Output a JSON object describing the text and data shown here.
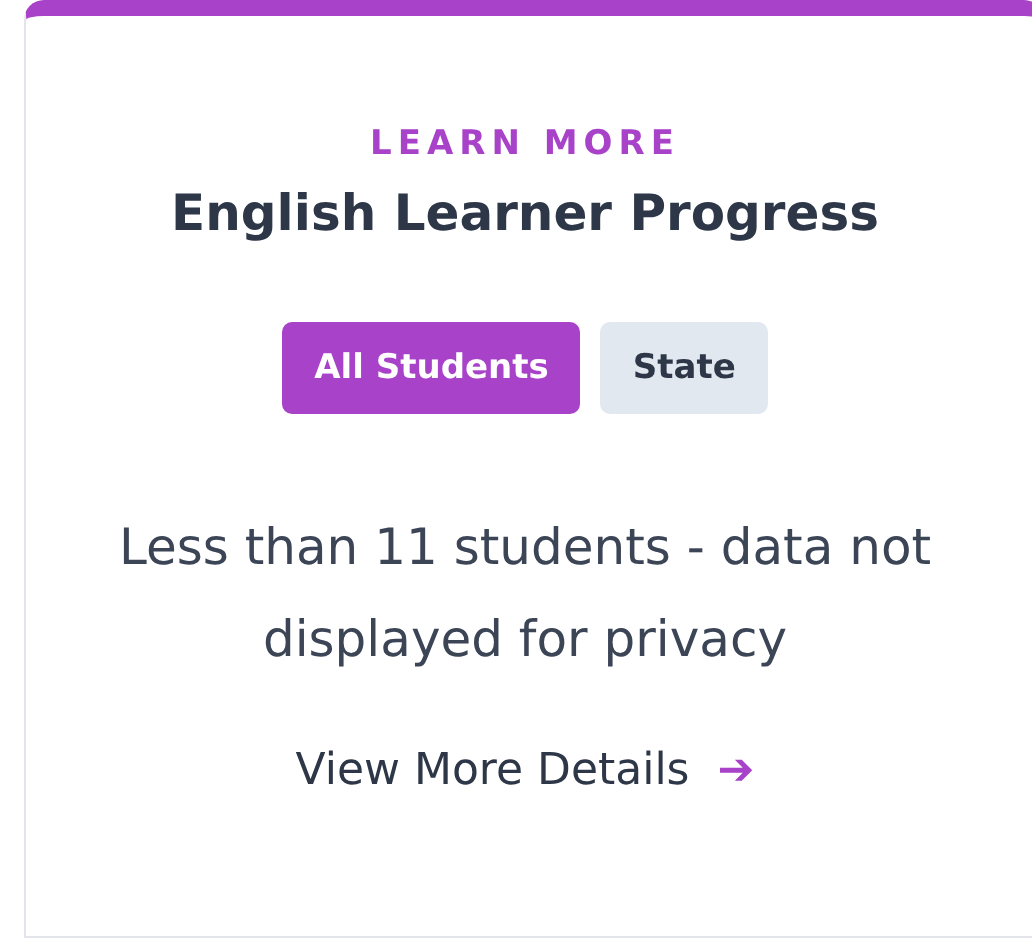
{
  "card": {
    "eyebrow": "LEARN MORE",
    "title": "English Learner Progress",
    "tabs": [
      {
        "label": "All Students",
        "selected": true
      },
      {
        "label": "State",
        "selected": false
      }
    ],
    "message": "Less than 11 students - data not displayed for privacy",
    "link": {
      "label": "View More Details",
      "icon": "➔"
    }
  }
}
